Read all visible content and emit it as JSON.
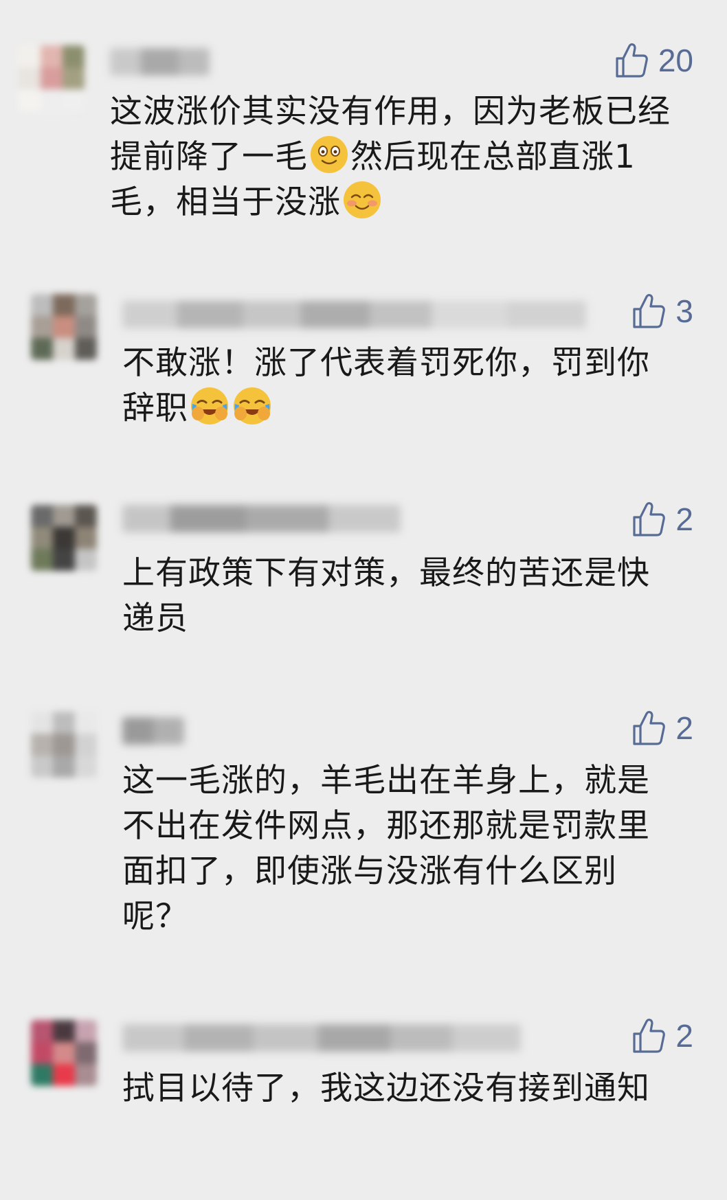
{
  "comments": [
    {
      "like_count": "20",
      "text_parts": [
        "这波涨价其实没有作用，因为老板已经提前降了一毛",
        "然后现在总部直涨1毛，相当于没涨",
        ""
      ],
      "emojis": [
        "smile-emoji",
        "blush-emoji"
      ]
    },
    {
      "like_count": "3",
      "text_parts": [
        "不敢涨！涨了代表着罚死你，罚到你辞职",
        "",
        ""
      ],
      "emojis": [
        "crying-laughing-emoji",
        "crying-laughing-emoji"
      ]
    },
    {
      "like_count": "2",
      "text": "上有政策下有对策，最终的苦还是快递员"
    },
    {
      "like_count": "2",
      "text": "这一毛涨的，羊毛出在羊身上，就是不出在发件网点，那还那就是罚款里面扣了，即使涨与没涨有什么区别呢？"
    },
    {
      "like_count": "2",
      "text": "拭目以待了，我这边还没有接到通知"
    }
  ],
  "colors": {
    "background": "#ededed",
    "text": "#191919",
    "like": "#576b95"
  },
  "icons": {
    "like": "thumbs-up-outline-icon"
  }
}
